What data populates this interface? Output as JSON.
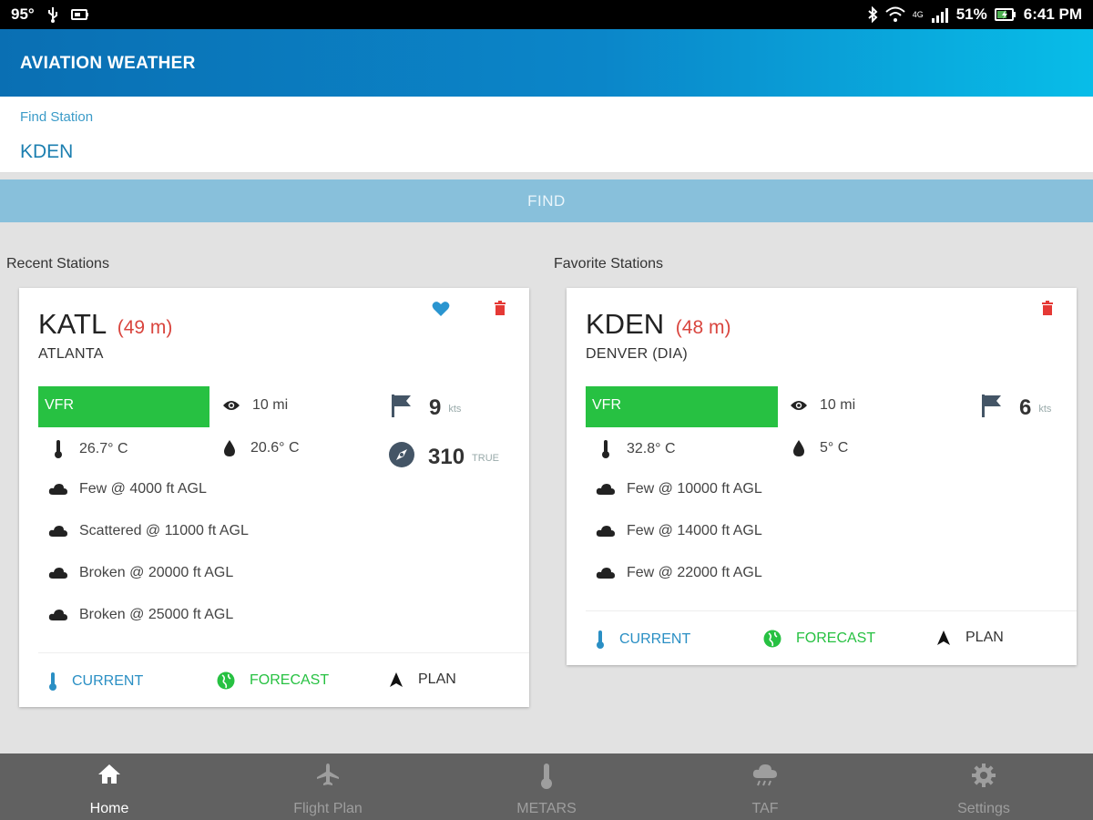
{
  "status_bar": {
    "temperature": "95°",
    "battery": "51%",
    "time": "6:41 PM",
    "network": "4G"
  },
  "app": {
    "title": "AVIATION WEATHER"
  },
  "search": {
    "label": "Find Station",
    "value": "KDEN",
    "button": "FIND"
  },
  "sections": {
    "recent": "Recent Stations",
    "favorite": "Favorite Stations"
  },
  "recent_card": {
    "code": "KATL",
    "age": "(49 m)",
    "city": "ATLANTA",
    "category": "VFR",
    "visibility": "10 mi",
    "temperature": "26.7° C",
    "dewpoint": "20.6° C",
    "wind_speed": "9",
    "wind_unit": "kts",
    "wind_dir": "310",
    "wind_dir_unit": "TRUE",
    "clouds": [
      "Few @ 4000 ft AGL",
      "Scattered @ 11000 ft AGL",
      "Broken @ 20000 ft AGL",
      "Broken @ 25000 ft AGL"
    ],
    "actions": {
      "current": "CURRENT",
      "forecast": "FORECAST",
      "plan": "PLAN"
    }
  },
  "favorite_card": {
    "code": "KDEN",
    "age": "(48 m)",
    "city": "DENVER (DIA)",
    "category": "VFR",
    "visibility": "10 mi",
    "temperature": "32.8° C",
    "dewpoint": "5° C",
    "wind_speed": "6",
    "wind_unit": "kts",
    "clouds": [
      "Few @ 10000 ft AGL",
      "Few @ 14000 ft AGL",
      "Few @ 22000 ft AGL"
    ],
    "actions": {
      "current": "CURRENT",
      "forecast": "FORECAST",
      "plan": "PLAN"
    }
  },
  "bottom_nav": {
    "items": [
      {
        "label": "Home",
        "icon": "home-icon",
        "active": true
      },
      {
        "label": "Flight Plan",
        "icon": "airplane-icon",
        "active": false
      },
      {
        "label": "METARS",
        "icon": "thermometer-icon",
        "active": false
      },
      {
        "label": "TAF",
        "icon": "cloud-rain-icon",
        "active": false
      },
      {
        "label": "Settings",
        "icon": "gear-icon",
        "active": false
      }
    ]
  },
  "colors": {
    "appbar_start": "#0a6fb3",
    "appbar_end": "#08bde8",
    "vfr": "#27c142",
    "age": "#d9453e",
    "current": "#2a8fc4",
    "forecast": "#27c142",
    "nav_bg": "#616161"
  }
}
